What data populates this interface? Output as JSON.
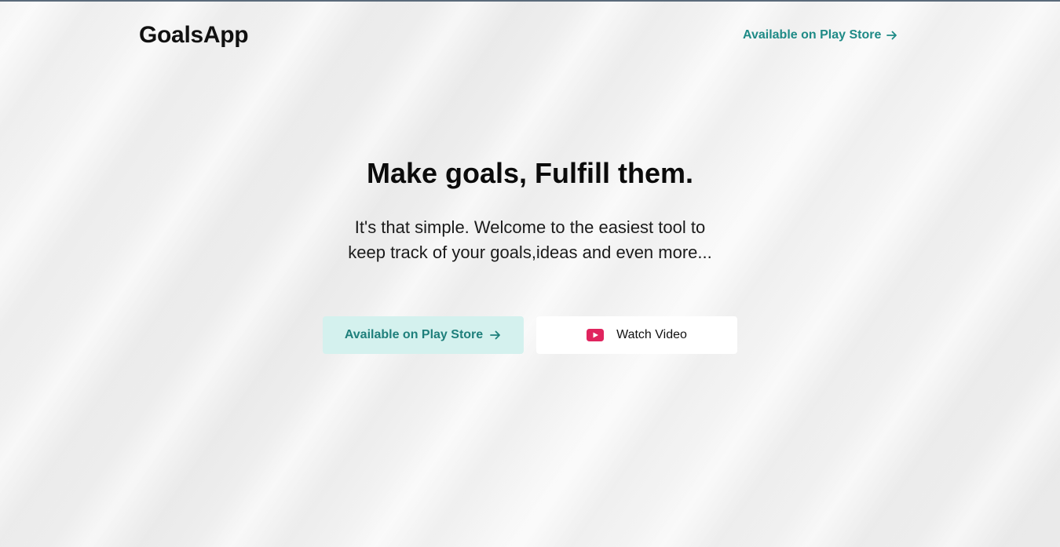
{
  "nav": {
    "logo": "GoalsApp",
    "cta_label": "Available on Play Store"
  },
  "hero": {
    "title": "Make goals, Fulfill them.",
    "subtitle": "It's that simple. Welcome to the easiest tool to keep track of your goals,ideas and even more...",
    "play_button_label": "Available on Play Store",
    "video_button_label": "Watch Video"
  },
  "icons": {
    "arrow": "arrow-right-icon",
    "video": "youtube-play-icon"
  },
  "colors": {
    "accent": "#1e8a86",
    "play_button_bg": "#d4f1ee",
    "video_icon": "#e0245e"
  }
}
